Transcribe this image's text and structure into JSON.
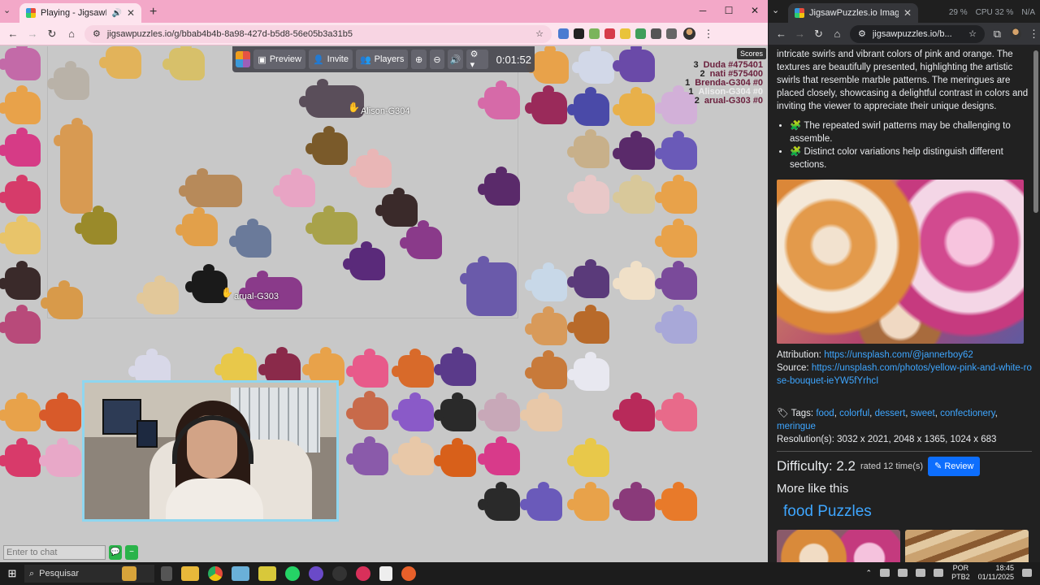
{
  "left_window": {
    "tab_title": "Playing - JigsawPuzzles.io",
    "url": "jigsawpuzzles.io/g/bbab4b4b-8a98-427d-b5d8-56e05b3a31b5"
  },
  "toolbar": {
    "preview": "Preview",
    "invite": "Invite",
    "players": "Players",
    "timer": "0:01:52"
  },
  "scores_button": "Scores",
  "scores": [
    {
      "count": "3",
      "name": "Duda #475401"
    },
    {
      "count": "2",
      "name": "nati #575400"
    },
    {
      "count": "1",
      "name": "Brenda-G304 #0"
    },
    {
      "count": "1",
      "name": "Alison-G304 #0"
    },
    {
      "count": "2",
      "name": "arual-G303 #0"
    }
  ],
  "player_labels": {
    "alison": "Alison-G304",
    "arual": "arual-G303"
  },
  "chat": {
    "placeholder": "Enter to chat"
  },
  "right_window": {
    "tab_title": "JigsawPuzzles.io Image - Vibra",
    "url": "jigsawpuzzles.io/b...",
    "perf": {
      "ram": "29 %",
      "cpu": "CPU 32 %",
      "gpu": "N/A"
    },
    "description": "intricate swirls and vibrant colors of pink and orange. The textures are beautifully presented, highlighting the artistic swirls that resemble marble patterns. The meringues are placed closely, showcasing a delightful contrast in colors and inviting the viewer to appreciate their unique designs.",
    "bullets": [
      "The repeated swirl patterns may be challenging to assemble.",
      "Distinct color variations help distinguish different sections."
    ],
    "attribution_label": "Attribution:",
    "attribution_link": "https://unsplash.com/@jannerboy62",
    "source_label": "Source:",
    "source_link": "https://unsplash.com/photos/yellow-pink-and-white-rose-bouquet-ieYW5fYrhcI",
    "tags_label": "Tags:",
    "tags": [
      "food",
      "colorful",
      "dessert",
      "sweet",
      "confectionery",
      "meringue"
    ],
    "resolution": "Resolution(s): 3032 x 2021, 2048 x 1365, 1024 x 683",
    "difficulty": "Difficulty: 2.2",
    "rated": "rated 12 time(s)",
    "review": "Review",
    "more_like": "More like this",
    "category": "food Puzzles"
  },
  "taskbar": {
    "search": "Pesquisar",
    "lang1": "POR",
    "lang2": "PTB2",
    "time": "18:45",
    "date": "01/11/2025"
  }
}
